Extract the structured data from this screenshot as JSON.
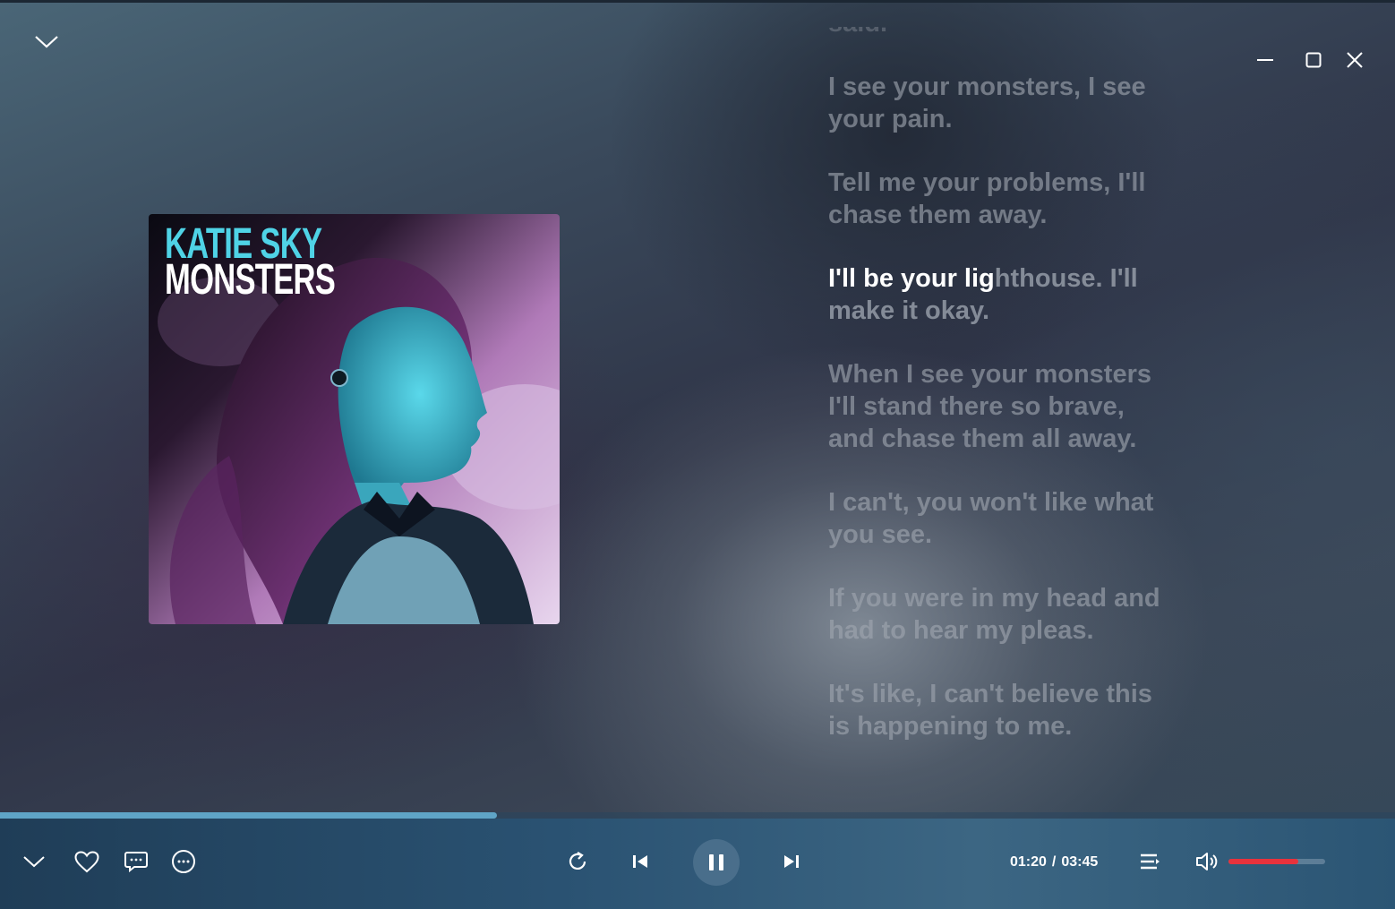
{
  "window": {
    "collapse_icon": "chevron-down-icon",
    "controls": [
      "minimize-icon",
      "maximize-icon",
      "close-icon"
    ]
  },
  "album": {
    "artist_text": "KATIE SKY",
    "title_text": "MONSTERS"
  },
  "lyrics": {
    "partial_top": "said.",
    "lines": [
      "I see your monsters, I see\nyour pain.",
      "Tell me your problems, I'll\nchase them away.",
      "When I see your monsters\nI'll stand there so brave,\nand chase them all away.",
      "I can't, you won't like what\nyou see.",
      "If you were in my head and\nhad to hear my pleas.",
      "It's like, I can't believe this\nis happening to me."
    ],
    "active_sung": "I'll be your lig",
    "active_unsung": "hthouse. I'll\nmake it okay."
  },
  "playback": {
    "progress_fraction": 0.356,
    "current_time": "01:20",
    "separator": "/",
    "total_time": "03:45",
    "volume_fraction": 0.72,
    "colors": {
      "progress": "#5fa4c6",
      "volume": "#e8323c",
      "active_lyric": "#ffffff"
    }
  },
  "controls": {
    "left": [
      "chevron-down-icon",
      "heart-icon",
      "comment-icon",
      "more-icon"
    ],
    "center": [
      "repeat-icon",
      "previous-icon",
      "pause-icon",
      "next-icon"
    ],
    "right": [
      "playlist-icon",
      "volume-icon"
    ]
  }
}
